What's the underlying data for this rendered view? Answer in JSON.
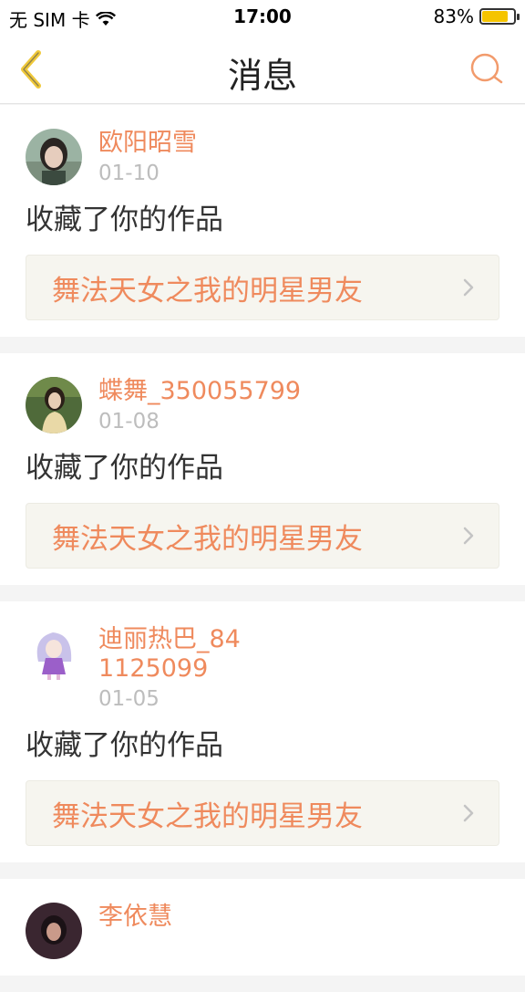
{
  "status_bar": {
    "carrier": "无 SIM 卡",
    "time": "17:00",
    "battery_percent": "83%",
    "battery_level": 0.83
  },
  "nav": {
    "title": "消息",
    "back_icon": "chevron-left-icon",
    "search_icon": "search-icon"
  },
  "colors": {
    "accent": "#ef8a5d",
    "back_icon": "#f0c93a",
    "date": "#bdbdbd"
  },
  "messages": [
    {
      "name": "欧阳昭雪",
      "date": "01-10",
      "action": "收藏了你的作品",
      "work_title": "舞法天女之我的明星男友"
    },
    {
      "name": "蝶舞_350055799",
      "date": "01-08",
      "action": "收藏了你的作品",
      "work_title": "舞法天女之我的明星男友"
    },
    {
      "name": "迪丽热巴_841125099",
      "date": "01-05",
      "action": "收藏了你的作品",
      "work_title": "舞法天女之我的明星男友"
    },
    {
      "name": "李依慧"
    }
  ]
}
